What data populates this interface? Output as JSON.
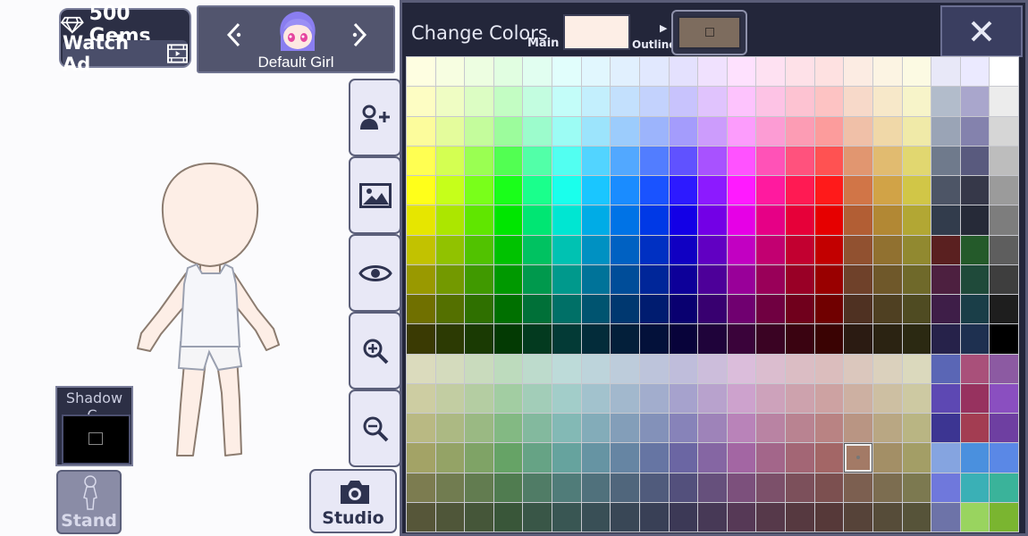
{
  "header": {
    "gems_text": "500 Gems",
    "watch_ad_text": "Watch Ad",
    "character_name": "Default Girl"
  },
  "sidebar": {
    "studio_label": "Studio",
    "stand_label": "Stand",
    "shadow_label": "Shadow C."
  },
  "color_panel": {
    "title": "Change Colors",
    "main_label": "Main",
    "outline_label": "Outline",
    "main_color": "#fdeee6",
    "outline_color": "#7d6c5e",
    "close_label": "X",
    "selected_row": 13,
    "selected_col": 15
  },
  "icons": [
    "gem-icon",
    "video-ad-icon",
    "chevron-left-icon",
    "chevron-right-icon",
    "character-avatar-icon",
    "add-person-icon",
    "background-image-icon",
    "eye-icon",
    "zoom-in-icon",
    "zoom-out-icon",
    "camera-icon",
    "stand-figure-icon",
    "close-icon"
  ]
}
